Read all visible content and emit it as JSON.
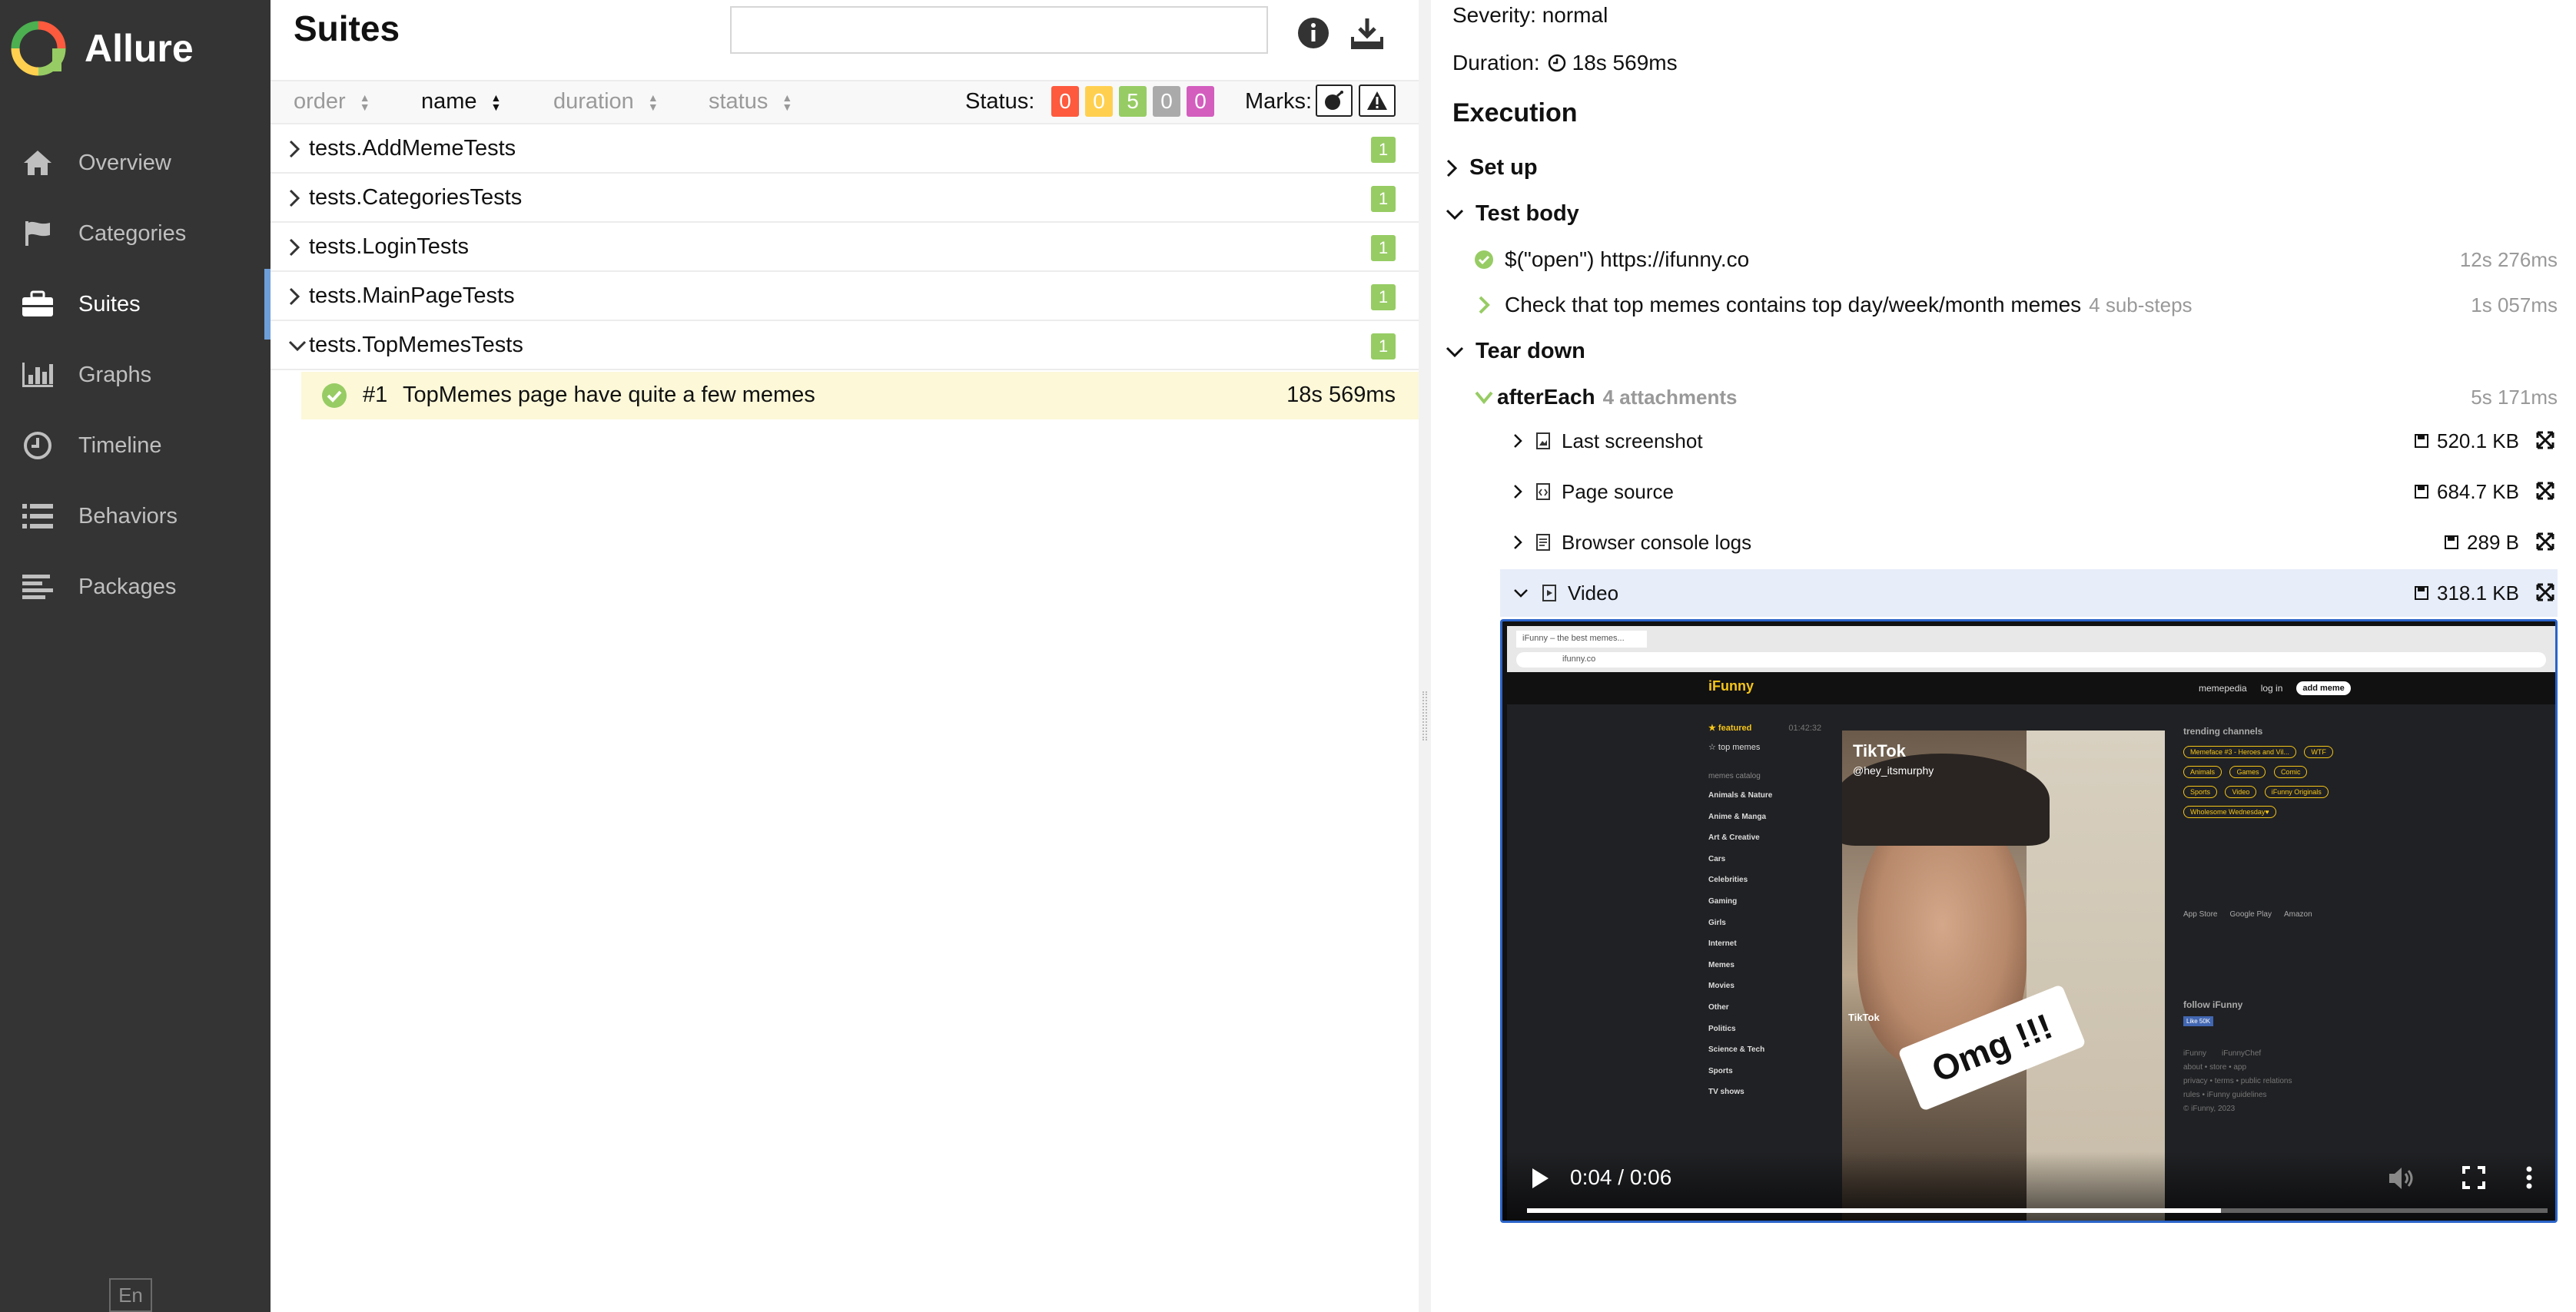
{
  "sidebar": {
    "brand": "Allure",
    "items": [
      {
        "label": "Overview",
        "icon": "home-icon"
      },
      {
        "label": "Categories",
        "icon": "flag-icon"
      },
      {
        "label": "Suites",
        "icon": "briefcase-icon"
      },
      {
        "label": "Graphs",
        "icon": "bar-chart-icon"
      },
      {
        "label": "Timeline",
        "icon": "clock-icon"
      },
      {
        "label": "Behaviors",
        "icon": "list-icon"
      },
      {
        "label": "Packages",
        "icon": "align-left-icon"
      }
    ],
    "active": "Suites",
    "language": "En"
  },
  "suites": {
    "title": "Suites",
    "search_value": "",
    "sort": {
      "order": "order",
      "name": "name",
      "duration": "duration",
      "status": "status"
    },
    "status_label": "Status:",
    "status_counts": [
      {
        "value": "0",
        "color": "#fd5a3e"
      },
      {
        "value": "0",
        "color": "#ffd050"
      },
      {
        "value": "5",
        "color": "#97cc64"
      },
      {
        "value": "0",
        "color": "#aaaaaa"
      },
      {
        "value": "0",
        "color": "#d35ebe"
      }
    ],
    "marks_label": "Marks:",
    "rows": [
      {
        "name": "tests.AddMemeTests",
        "count": "1"
      },
      {
        "name": "tests.CategoriesTests",
        "count": "1"
      },
      {
        "name": "tests.LoginTests",
        "count": "1"
      },
      {
        "name": "tests.MainPageTests",
        "count": "1"
      },
      {
        "name": "tests.TopMemesTests",
        "count": "1"
      }
    ],
    "selected_case": {
      "number": "#1",
      "name": "TopMemes page have quite a few memes",
      "duration": "18s 569ms"
    }
  },
  "details": {
    "severity": "Severity: normal",
    "duration_label": "Duration:",
    "duration_value": "18s 569ms",
    "execution_title": "Execution",
    "setup": "Set up",
    "test_body": "Test body",
    "steps": [
      {
        "name": "$(\"open\") https://ifunny.co",
        "sub": "",
        "duration": "12s 276ms"
      },
      {
        "name": "Check that top memes contains top day/week/month memes",
        "sub": "4 sub-steps",
        "duration": "1s 057ms"
      }
    ],
    "teardown": "Tear down",
    "after_each": {
      "name": "afterEach",
      "sub": "4 attachments",
      "duration": "5s 171ms"
    },
    "attachments": [
      {
        "name": "Last screenshot",
        "size": "520.1 KB"
      },
      {
        "name": "Page source",
        "size": "684.7 KB"
      },
      {
        "name": "Browser console logs",
        "size": "289 B"
      },
      {
        "name": "Video",
        "size": "318.1 KB"
      }
    ]
  },
  "video": {
    "time": "0:04 / 0:06",
    "progress": 0.68,
    "browser_tab": "iFunny – the best memes...",
    "browser_url": "ifunny.co",
    "site": {
      "logo": "iFunny",
      "nav_memepedia": "memepedia",
      "nav_login": "log in",
      "nav_add": "add meme",
      "featured": "featured",
      "featured_time": "01:42:32",
      "top_memes": "top memes",
      "catalog_header": "memes catalog",
      "categories": [
        "Animals & Nature",
        "Anime & Manga",
        "Art & Creative",
        "Cars",
        "Celebrities",
        "Gaming",
        "Girls",
        "Internet",
        "Memes",
        "Movies",
        "Other",
        "Politics",
        "Science & Tech",
        "Sports",
        "TV shows"
      ],
      "clip_brand": "TikTok",
      "clip_user": "@hey_itsmurphy",
      "clip_caption": "Omg !!!",
      "trending_header": "trending channels",
      "channels": [
        "Memeface #3 - Heroes and Vil...",
        "WTF",
        "Animals",
        "Games",
        "Comic",
        "Sports",
        "Video",
        "iFunny Originals",
        "Wholesome Wednesday♥"
      ],
      "stores": [
        "App Store",
        "Google Play",
        "Amazon"
      ],
      "follow": "follow iFunny",
      "fb_like": "Like 50K",
      "footer": [
        "iFunny",
        "iFunnyChef",
        "about • store • app",
        "privacy • terms • public relations",
        "rules • iFunny guidelines",
        "© iFunny, 2023"
      ]
    }
  }
}
